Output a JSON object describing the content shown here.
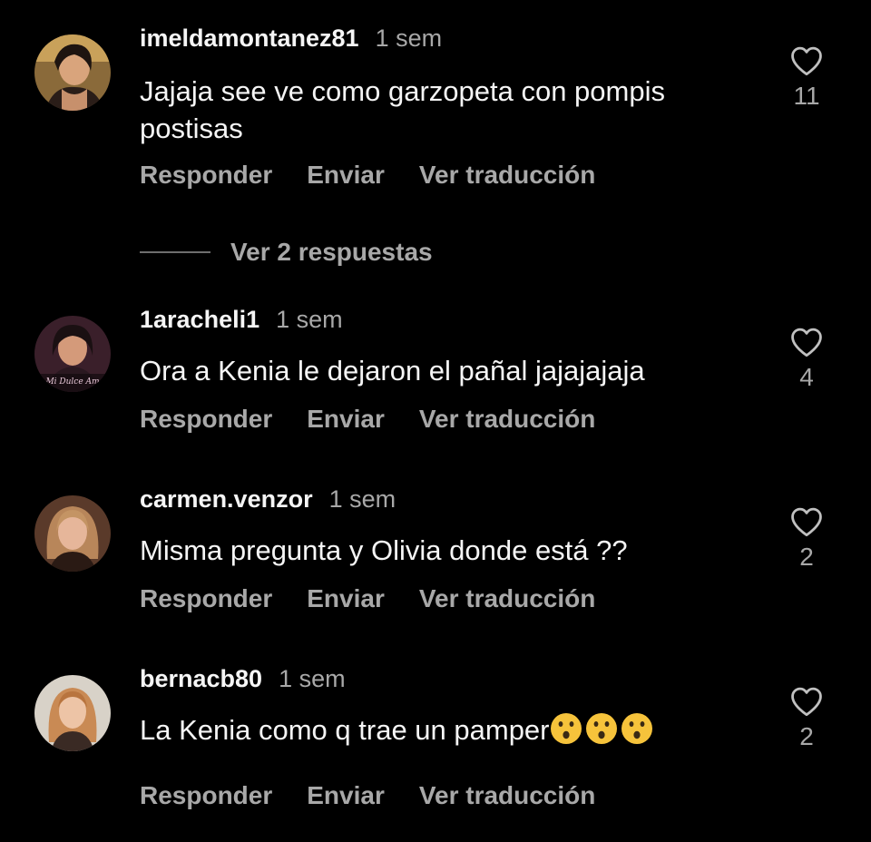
{
  "actions": {
    "reply": "Responder",
    "send": "Enviar",
    "translate": "Ver traducción"
  },
  "comments": [
    {
      "username": "imeldamontanez81",
      "time": "1 sem",
      "text_line1": "Jajaja see ve como garzopeta con pompis",
      "text_line2": "postisas",
      "likes": "11",
      "view_replies": "Ver 2 respuestas"
    },
    {
      "username": "1aracheli1",
      "time": "1 sem",
      "text": "Ora a Kenia le dejaron el pañal  jajajajaja",
      "likes": "4",
      "avatar_caption": "Mi Dulce Am"
    },
    {
      "username": "carmen.venzor",
      "time": "1 sem",
      "text": "Misma pregunta y Olivia donde está ??",
      "likes": "2"
    },
    {
      "username": "bernacb80",
      "time": "1 sem",
      "text": "La Kenia como q trae un pamper",
      "emoji": "hushed-face",
      "likes": "2"
    }
  ],
  "colors": {
    "background": "#000000",
    "primary_text": "#f5f5f5",
    "secondary_text": "#a8a8a8",
    "emoji_yellow": "#f6c33b"
  }
}
